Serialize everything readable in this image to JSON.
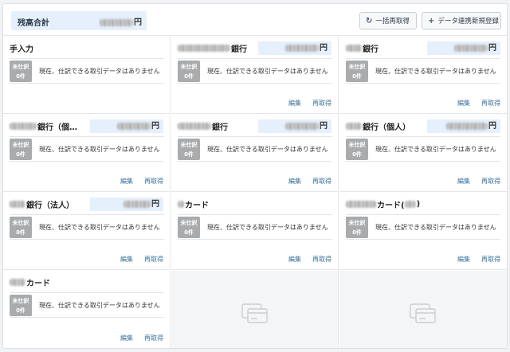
{
  "header": {
    "balance_label": "残高合計",
    "balance_currency": "円",
    "refresh_all_label": "一括再取得",
    "add_connection_label": "データ連携新規登録"
  },
  "cards": [
    {
      "title": "手入力",
      "has_amount": false,
      "badge_line1": "未仕訳",
      "badge_line2": "0件",
      "message": "現在、仕訳できる取引データはありません",
      "edit": "",
      "refetch": ""
    },
    {
      "title": "銀行",
      "has_amount": true,
      "currency": "円",
      "badge_line1": "未仕訳",
      "badge_line2": "0件",
      "message": "現在、仕訳できる取引データはありません",
      "edit": "編集",
      "refetch": "再取得"
    },
    {
      "title": "銀行",
      "has_amount": true,
      "currency": "円",
      "badge_line1": "未仕訳",
      "badge_line2": "0件",
      "message": "現在、仕訳できる取引データはありません",
      "edit": "編集",
      "refetch": "再取得"
    },
    {
      "title": "銀行（個…",
      "has_amount": true,
      "currency": "円",
      "badge_line1": "未仕訳",
      "badge_line2": "0件",
      "message": "現在、仕訳できる取引データはありません",
      "edit": "編集",
      "refetch": "再取得"
    },
    {
      "title": "銀行",
      "has_amount": true,
      "currency": "円",
      "badge_line1": "未仕訳",
      "badge_line2": "0件",
      "message": "現在、仕訳できる取引データはありません",
      "edit": "編集",
      "refetch": "再取得"
    },
    {
      "title": "銀行（個人）",
      "has_amount": true,
      "currency": "円",
      "badge_line1": "未仕訳",
      "badge_line2": "0件",
      "message": "現在、仕訳できる取引データはありません",
      "edit": "編集",
      "refetch": "再取得"
    },
    {
      "title": "銀行（法人）",
      "has_amount": true,
      "currency": "円",
      "badge_line1": "未仕訳",
      "badge_line2": "0件",
      "message": "現在、仕訳できる取引データはありません",
      "edit": "編集",
      "refetch": "再取得"
    },
    {
      "title": "カード",
      "has_amount": false,
      "badge_line1": "未仕訳",
      "badge_line2": "0件",
      "message": "現在、仕訳できる取引データはありません",
      "edit": "編集",
      "refetch": "再取得"
    },
    {
      "title": "カード(",
      "title_suffix": ")",
      "has_amount": false,
      "badge_line1": "未仕訳",
      "badge_line2": "0件",
      "message": "現在、仕訳できる取引データはありません",
      "edit": "編集",
      "refetch": "再取得"
    },
    {
      "title": "カード",
      "has_amount": false,
      "badge_line1": "未仕訳",
      "badge_line2": "0件",
      "message": "現在、仕訳できる取引データはありません",
      "edit": "編集",
      "refetch": "再取得"
    }
  ],
  "colors": {
    "accent": "#e6f0fd",
    "badge": "#a9abad",
    "link": "#3a6e96",
    "empty_tile": "#f4f5f7"
  },
  "icons": {
    "refresh": "refresh-icon",
    "add": "plus-icon",
    "placeholder": "credit-card-icon"
  }
}
